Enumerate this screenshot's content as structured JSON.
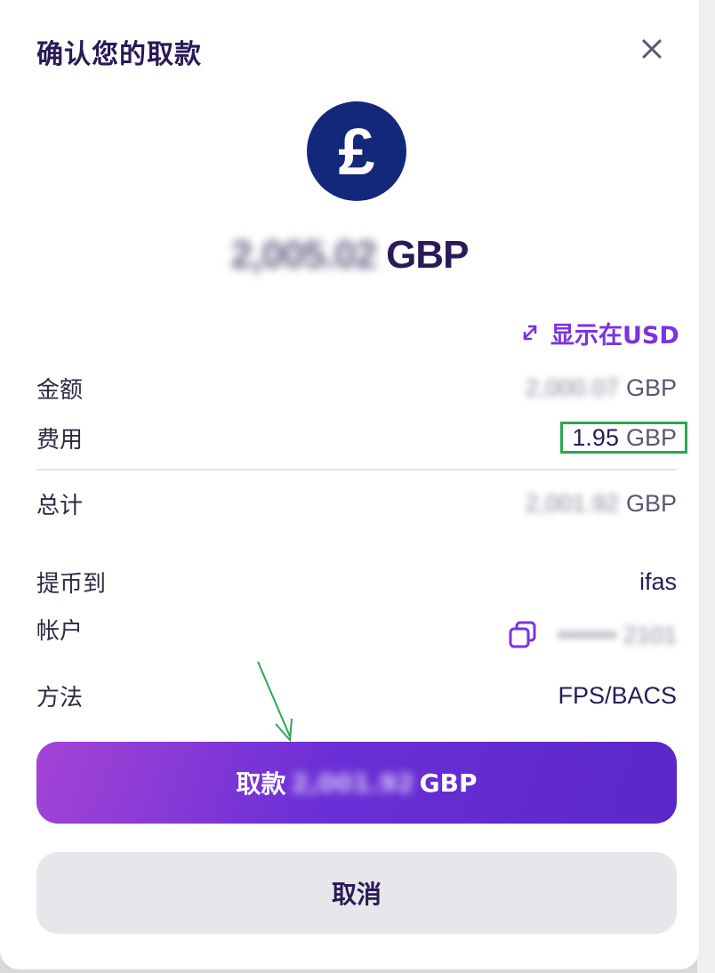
{
  "dialog": {
    "title": "确认您的取款",
    "close_icon": "close-icon",
    "currency_icon": "pound-sterling-icon",
    "currency_symbol": "£",
    "amount_hidden": "2,005.02",
    "amount_currency": "GBP",
    "toggle_icon": "swap-arrows-icon",
    "toggle_label": "显示在USD"
  },
  "details": {
    "amount": {
      "label": "金额",
      "value_hidden": "2,000.07",
      "currency": "GBP"
    },
    "fee": {
      "label": "费用",
      "value": "1.95",
      "currency": "GBP",
      "highlight_color": "#2aa84f"
    },
    "total": {
      "label": "总计",
      "value_hidden": "2,001.92",
      "currency": "GBP"
    },
    "withdraw_to": {
      "label": "提币到",
      "value": "ifas"
    },
    "account": {
      "label": "帐户",
      "copy_icon": "copy-icon",
      "value": "••••••• 2101"
    },
    "method": {
      "label": "方法",
      "value": "FPS/BACS"
    }
  },
  "actions": {
    "withdraw_label": "取款",
    "withdraw_amount_hidden": "2,001.92",
    "withdraw_currency": "GBP",
    "cancel_label": "取消"
  },
  "colors": {
    "brand": "#2a1a57",
    "accent": "#7b33e0",
    "coin": "#13287a",
    "annotation": "#2aa84f"
  }
}
